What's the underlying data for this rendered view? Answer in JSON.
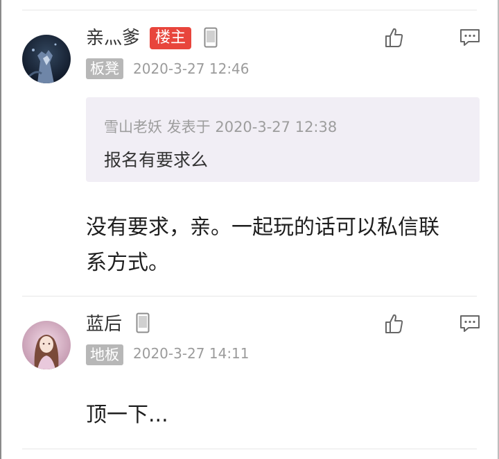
{
  "posts": [
    {
      "username": "亲灬爹",
      "host_badge": "楼主",
      "floor": "板凳",
      "timestamp": "2020-3-27 12:46",
      "quote": {
        "author_line": "雪山老妖 发表于 2020-3-27 12:38",
        "text": "报名有要求么"
      },
      "content_lines": [
        "没有要求，亲。一起玩的话可以私信联",
        "系方式。"
      ],
      "icons": {
        "device": "phone-icon",
        "like": "thumbs-up-icon",
        "comment": "comment-icon"
      }
    },
    {
      "username": "蓝后",
      "floor": "地板",
      "timestamp": "2020-3-27 14:11",
      "content_lines": [
        "顶一下..."
      ],
      "icons": {
        "device": "phone-icon",
        "like": "thumbs-up-icon",
        "comment": "comment-icon"
      }
    }
  ],
  "colors": {
    "host_badge": "#e8453c",
    "floor_badge": "#b7b7b7",
    "quote_background": "#f1eef5",
    "meta_text": "#9b9b9b"
  }
}
